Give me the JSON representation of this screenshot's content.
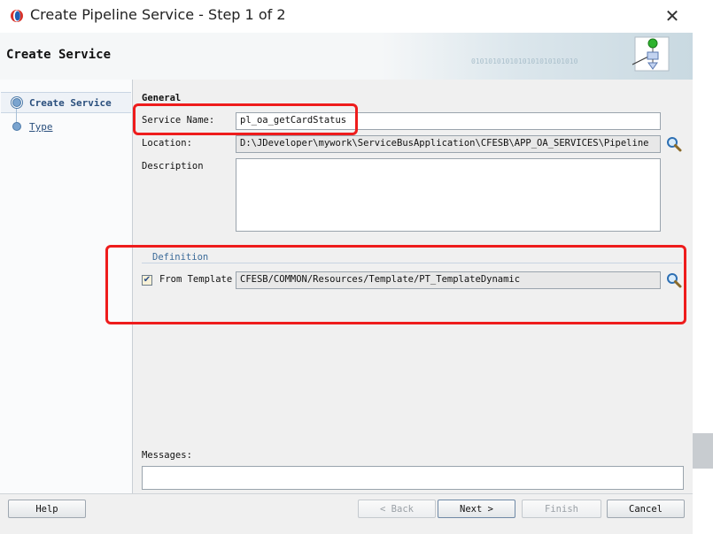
{
  "window": {
    "title": "Create Pipeline Service - Step 1 of 2",
    "close_glyph": "✕"
  },
  "header": {
    "title": "Create Service",
    "decor_text": "0101010101010101010101010"
  },
  "nav": {
    "items": [
      {
        "label": "Create Service",
        "active": true
      },
      {
        "label": "Type",
        "active": false
      }
    ]
  },
  "general": {
    "section_label": "General",
    "service_name_label": "Service Name:",
    "service_name_value": "pl_oa_getCardStatus",
    "location_label": "Location:",
    "location_value": "D:\\JDeveloper\\mywork\\ServiceBusApplication\\CFESB\\APP_OA_SERVICES\\Pipeline",
    "description_label": "Description",
    "description_value": ""
  },
  "definition": {
    "section_label": "Definition",
    "from_template_label": "From Template",
    "from_template_checked": true,
    "template_value": "CFESB/COMMON/Resources/Template/PT_TemplateDynamic"
  },
  "messages": {
    "label": "Messages:",
    "value": ""
  },
  "buttons": {
    "help": "Help",
    "back": "< Back",
    "next": "Next >",
    "finish": "Finish",
    "cancel": "Cancel"
  },
  "icons": {
    "app": "oracle-logo-icon",
    "search": "magnifier-icon",
    "header": "wizard-flow-icon"
  },
  "colors": {
    "annotation_red": "#ee1c1c",
    "nav_link": "#2a4f7d"
  }
}
